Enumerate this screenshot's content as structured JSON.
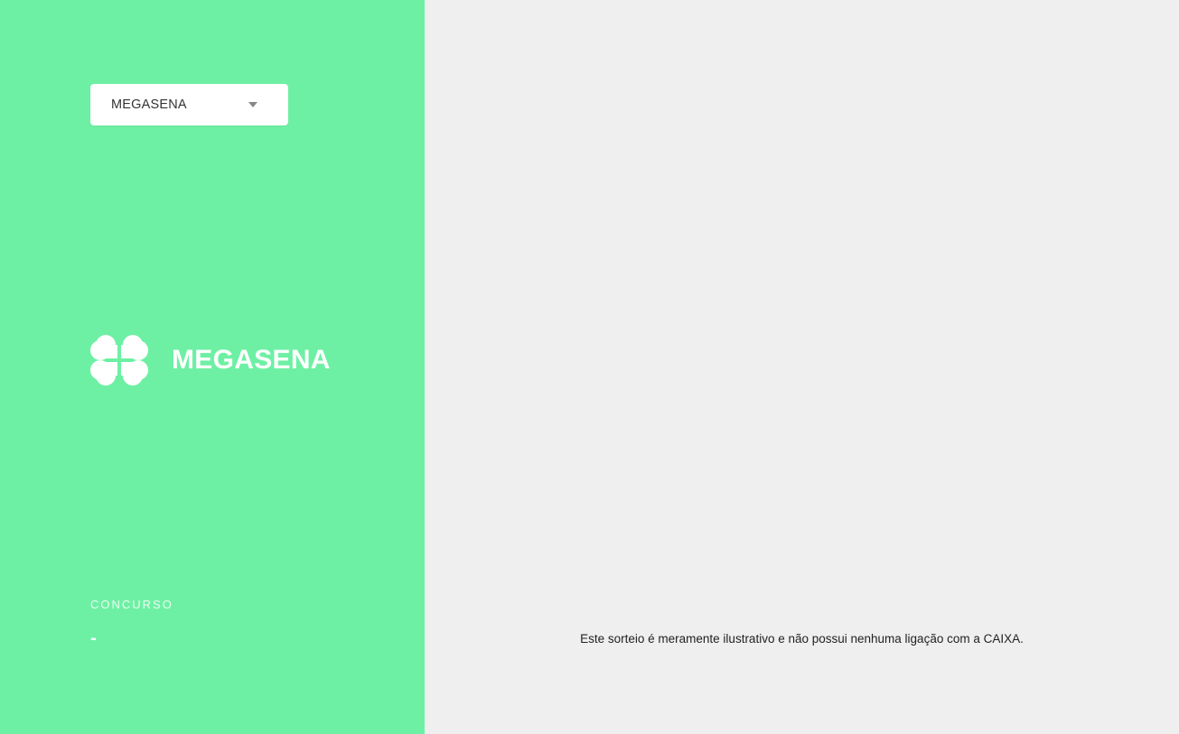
{
  "lottery_select": {
    "selected": "MEGASENA",
    "icon": "caret-down-icon"
  },
  "brand": {
    "logo_icon": "clover-icon",
    "name": "MEGASENA"
  },
  "concurso": {
    "label": "CONCURSO",
    "value": "-"
  },
  "footer": {
    "disclaimer": "Este sorteio é meramente ilustrativo e não possui nenhuma ligação com a CAIXA."
  },
  "colors": {
    "sidebar_bg": "#6ef0a4",
    "main_bg": "#efefef",
    "text_light": "#ffffff"
  }
}
